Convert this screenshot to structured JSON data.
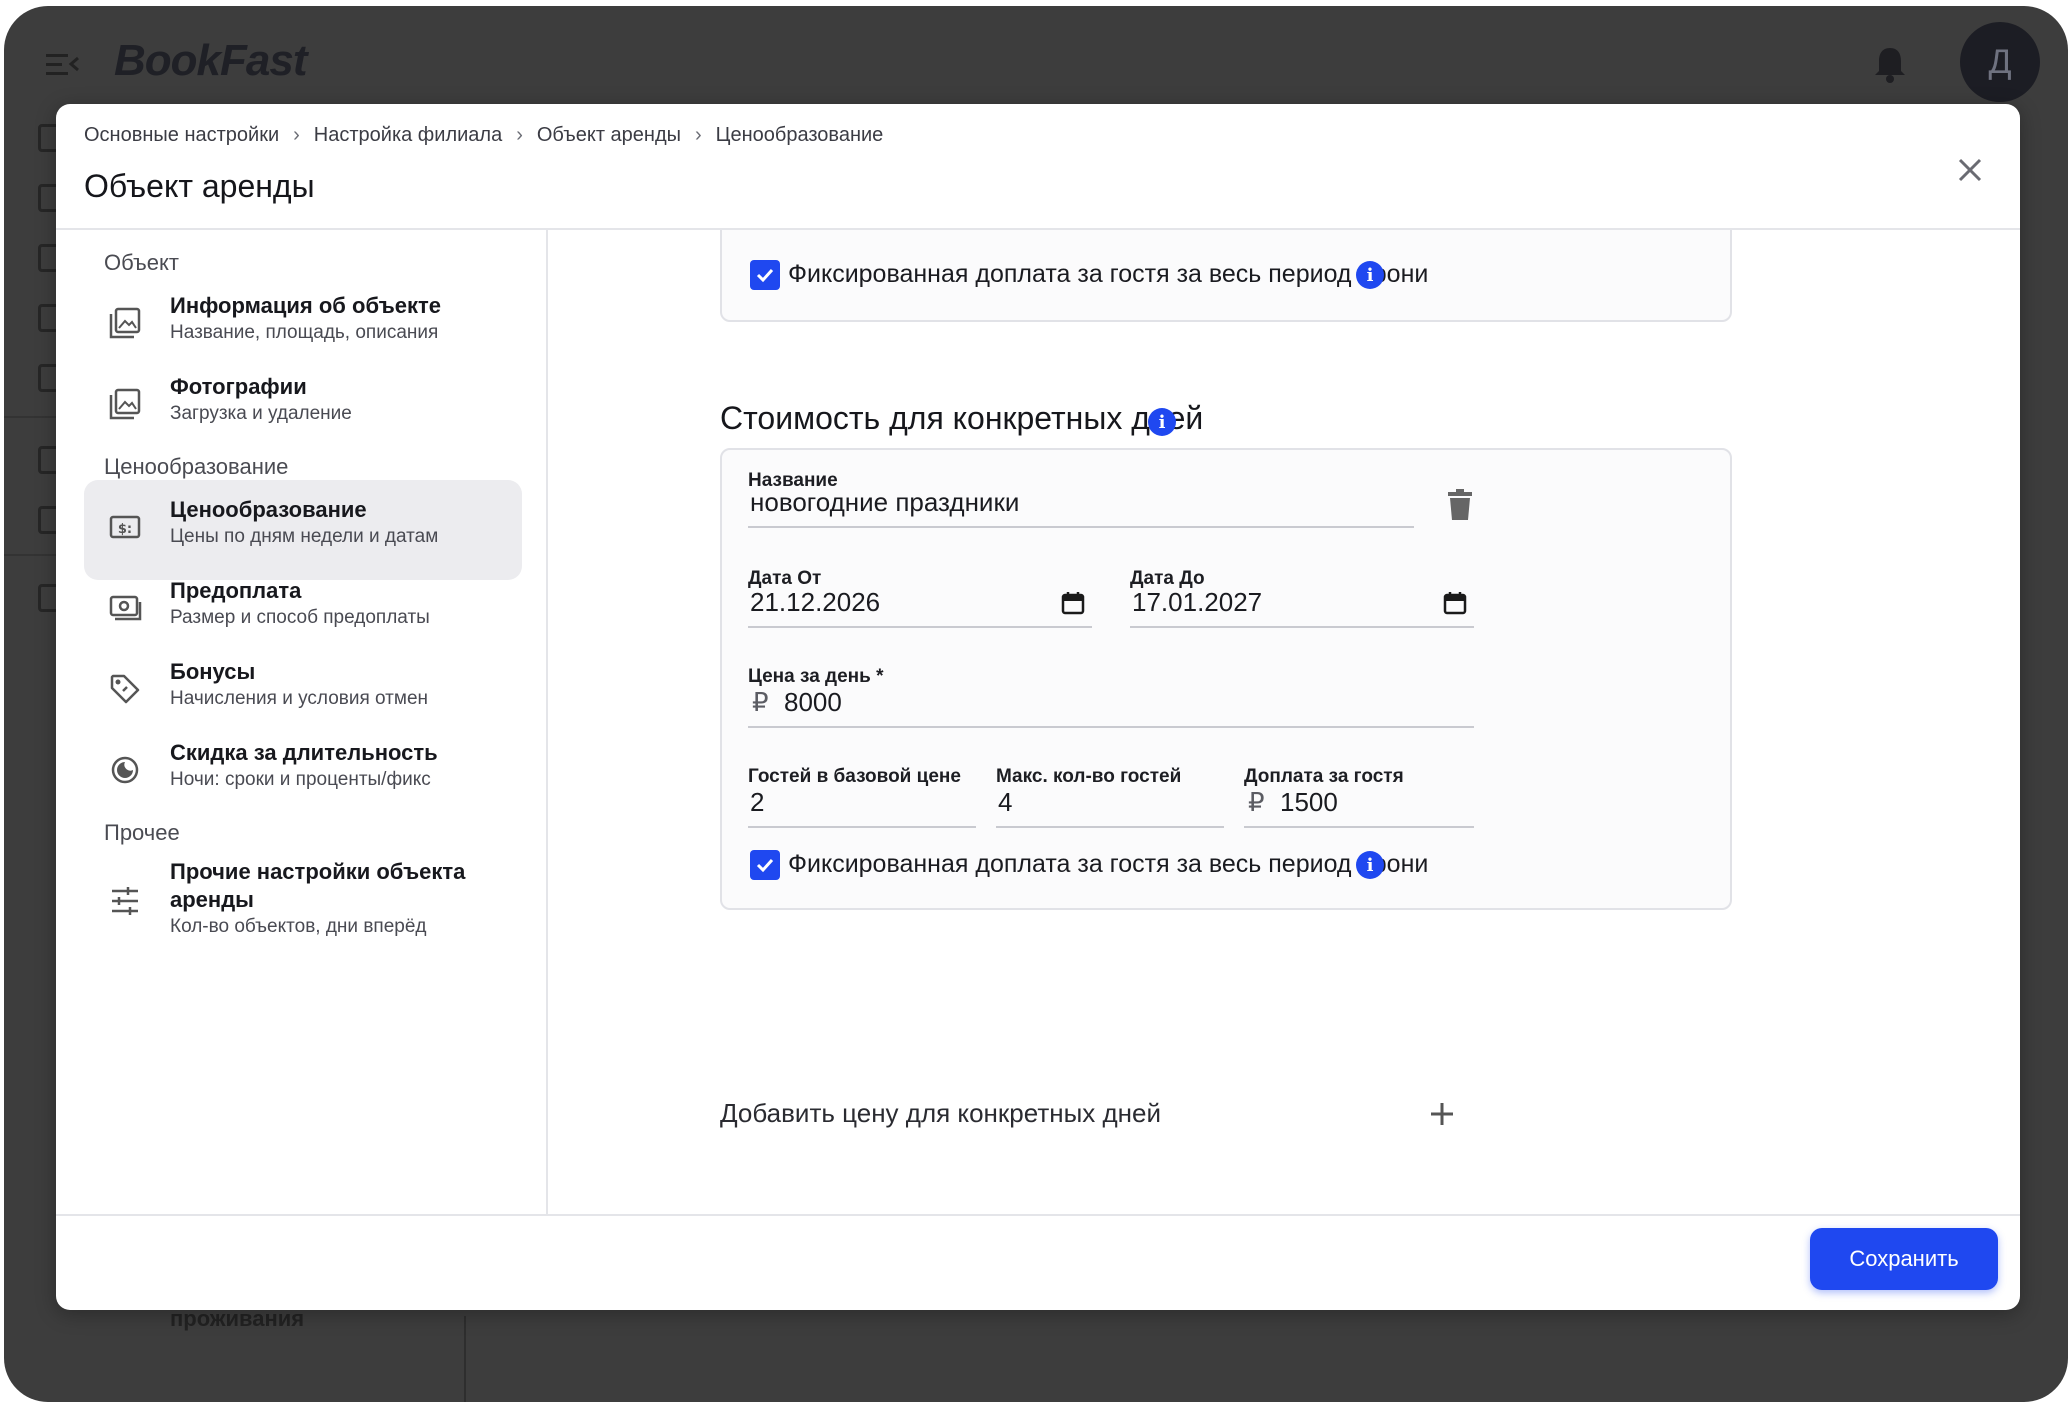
{
  "app": {
    "logo": "BookFast",
    "avatar_initial": "Д",
    "bottom_partial_text": "проживания"
  },
  "modal": {
    "breadcrumb": [
      "Основные настройки",
      "Настройка филиала",
      "Объект аренды",
      "Ценообразование"
    ],
    "breadcrumb_separator": "›",
    "title": "Объект аренды"
  },
  "nav": {
    "groups": [
      "Объект",
      "Ценообразование",
      "Прочее"
    ],
    "items": [
      {
        "title": "Информация об объекте",
        "subtitle": "Название, площадь, описания",
        "icon": "image-gallery-icon",
        "active": false
      },
      {
        "title": "Фотографии",
        "subtitle": "Загрузка и удаление",
        "icon": "image-gallery-icon",
        "active": false
      },
      {
        "title": "Ценообразование",
        "subtitle": "Цены по дням недели и датам",
        "icon": "price-tag-icon",
        "active": true
      },
      {
        "title": "Предоплата",
        "subtitle": "Размер и способ предоплаты",
        "icon": "cash-icon",
        "active": false
      },
      {
        "title": "Бонусы",
        "subtitle": "Начисления и условия отмен",
        "icon": "tag-icon",
        "active": false
      },
      {
        "title": "Скидка за длительность",
        "subtitle": "Ночи: сроки и проценты/фикс",
        "icon": "moon-icon",
        "active": false
      },
      {
        "title": "Прочие настройки объекта аренды",
        "subtitle": "Кол-во объектов, дни вперёд",
        "icon": "sliders-icon",
        "active": false
      }
    ]
  },
  "content": {
    "top_card": {
      "checkbox_label": "Фиксированная доплата за гостя за весь период брони",
      "checked": true
    },
    "section_title": "Стоимость для конкретных дней",
    "special_price": {
      "name_label": "Название",
      "name_value": "новогодние праздники",
      "date_from_label": "Дата От",
      "date_from_value": "21.12.2026",
      "date_to_label": "Дата До",
      "date_to_value": "17.01.2027",
      "price_label": "Цена за день *",
      "currency_symbol": "₽",
      "price_value": "8000",
      "guests_base_label": "Гостей в базовой цене",
      "guests_base_value": "2",
      "max_guests_label": "Макс. кол-во гостей",
      "max_guests_value": "4",
      "extra_guest_label": "Доплата за гостя",
      "extra_guest_value": "1500",
      "checkbox_label": "Фиксированная доплата за гостя за весь период брони",
      "checked": true
    },
    "add_label": "Добавить цену для конкретных дней"
  },
  "footer": {
    "save_label": "Сохранить"
  },
  "colors": {
    "accent": "#1f48f0",
    "backdrop": "#3d3d3d",
    "active_nav": "#ececef"
  }
}
